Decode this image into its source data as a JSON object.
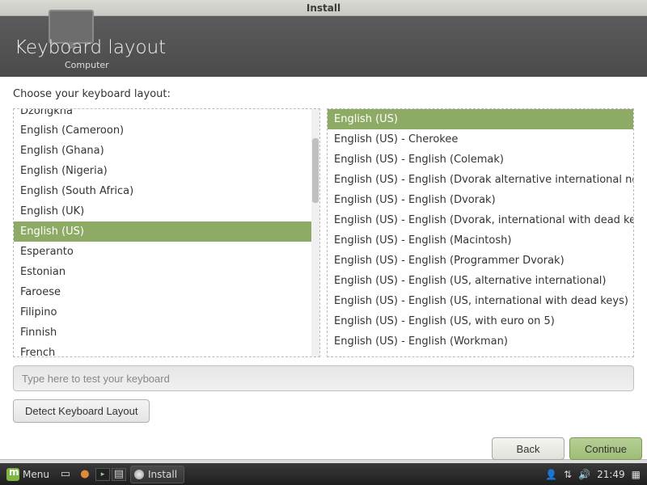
{
  "window": {
    "title": "Install"
  },
  "header": {
    "title": "Keyboard layout",
    "subtitle": "Computer"
  },
  "prompt": "Choose your keyboard layout:",
  "left_list": {
    "selected_index": 6,
    "items": [
      "Dzongkha",
      "English (Cameroon)",
      "English (Ghana)",
      "English (Nigeria)",
      "English (South Africa)",
      "English (UK)",
      "English (US)",
      "Esperanto",
      "Estonian",
      "Faroese",
      "Filipino",
      "Finnish",
      "French"
    ]
  },
  "right_list": {
    "selected_index": 0,
    "items": [
      "English (US)",
      "English (US) - Cherokee",
      "English (US) - English (Colemak)",
      "English (US) - English (Dvorak alternative international no dead keys)",
      "English (US) - English (Dvorak)",
      "English (US) - English (Dvorak, international with dead keys)",
      "English (US) - English (Macintosh)",
      "English (US) - English (Programmer Dvorak)",
      "English (US) - English (US, alternative international)",
      "English (US) - English (US, international with dead keys)",
      "English (US) - English (US, with euro on 5)",
      "English (US) - English (Workman)"
    ]
  },
  "test_input": {
    "placeholder": "Type here to test your keyboard"
  },
  "buttons": {
    "detect": "Detect Keyboard Layout",
    "back": "Back",
    "continue": "Continue"
  },
  "taskbar": {
    "menu": "Menu",
    "app": "Install",
    "time": "21:49"
  }
}
